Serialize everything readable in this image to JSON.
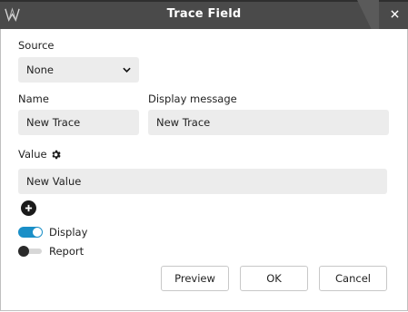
{
  "window": {
    "title": "Trace Field",
    "logo_icon": "app-logo-icon",
    "close_icon": "close-icon"
  },
  "source": {
    "label": "Source",
    "selected": "None",
    "icon": "chevron-down-icon"
  },
  "name": {
    "label": "Name",
    "value": "New Trace"
  },
  "display_message": {
    "label": "Display message",
    "value": "New Trace"
  },
  "value": {
    "label": "Value",
    "settings_icon": "gear-icon",
    "field_value": "New Value",
    "add_icon": "plus-circle-icon"
  },
  "toggles": {
    "display": {
      "label": "Display",
      "state": "on"
    },
    "report": {
      "label": "Report",
      "state": "off"
    }
  },
  "buttons": {
    "preview": "Preview",
    "ok": "OK",
    "cancel": "Cancel"
  },
  "colors": {
    "titlebar": "#4a4a4a",
    "accent": "#1a8fc7",
    "field_bg": "#ececec"
  }
}
